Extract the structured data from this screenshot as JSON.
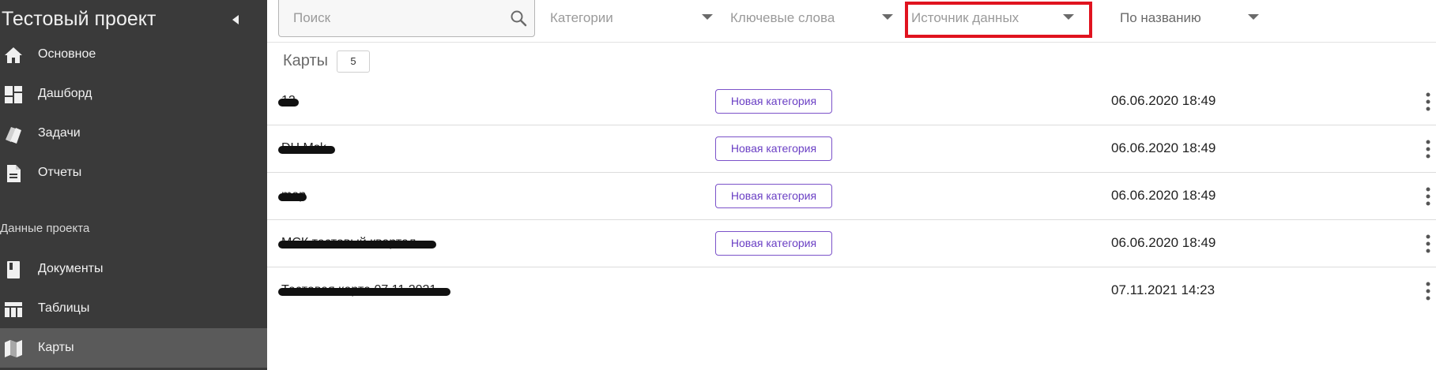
{
  "sidebar": {
    "project_title": "Тестовый проект",
    "collapse_icon": "chevron-left-icon",
    "nav_items": [
      {
        "label": "Основное",
        "icon": "home-icon"
      },
      {
        "label": "Дашборд",
        "icon": "dashboard-icon"
      },
      {
        "label": "Задачи",
        "icon": "tasks-icon"
      },
      {
        "label": "Отчеты",
        "icon": "report-icon"
      }
    ],
    "section_label": "Данные проекта",
    "data_items": [
      {
        "label": "Документы",
        "icon": "document-icon"
      },
      {
        "label": "Таблицы",
        "icon": "table-icon"
      },
      {
        "label": "Карты",
        "icon": "map-icon",
        "active": true
      }
    ]
  },
  "toolbar": {
    "search_placeholder": "Поиск",
    "filters": [
      {
        "label": "Категории"
      },
      {
        "label": "Ключевые слова"
      },
      {
        "label": "Источник данных",
        "highlighted": true
      },
      {
        "label": "По названию"
      }
    ]
  },
  "content": {
    "title": "Карты",
    "count": "5",
    "rows": [
      {
        "name": "12",
        "category": "Новая категория",
        "date": "06.06.2020 18:49"
      },
      {
        "name": "DH Msk",
        "category": "Новая категория",
        "date": "06.06.2020 18:49"
      },
      {
        "name": "map",
        "category": "Новая категория",
        "date": "06.06.2020 18:49"
      },
      {
        "name": "МСК тестовый квартал",
        "category": "Новая категория",
        "date": "06.06.2020 18:49"
      },
      {
        "name": "Тестовая карта 07.11.2021",
        "category": "",
        "date": "07.11.2021 14:23"
      }
    ]
  },
  "colors": {
    "sidebar_bg": "#3a3a3a",
    "active_item_bg": "#5a5a5a",
    "accent_purple": "#7b52c9",
    "highlight_red": "#e0131f"
  }
}
